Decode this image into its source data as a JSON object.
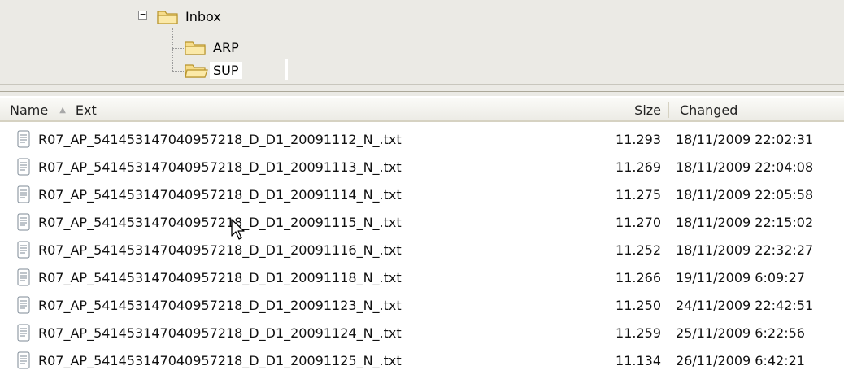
{
  "tree": {
    "nodes": [
      {
        "label": "Inbox",
        "expanded_symbol": "−"
      },
      {
        "label": "ARP"
      },
      {
        "label": "SUP"
      }
    ]
  },
  "list": {
    "columns": {
      "name": "Name",
      "ext": "Ext",
      "size": "Size",
      "changed": "Changed"
    },
    "sort_column": "name",
    "sort_direction": "ascending",
    "files": [
      {
        "name": "R07_AP_541453147040957218_D_D1_20091112_N_.txt",
        "size": "11.293",
        "changed": "18/11/2009 22:02:31"
      },
      {
        "name": "R07_AP_541453147040957218_D_D1_20091113_N_.txt",
        "size": "11.269",
        "changed": "18/11/2009 22:04:08"
      },
      {
        "name": "R07_AP_541453147040957218_D_D1_20091114_N_.txt",
        "size": "11.275",
        "changed": "18/11/2009 22:05:58"
      },
      {
        "name": "R07_AP_541453147040957218_D_D1_20091115_N_.txt",
        "size": "11.270",
        "changed": "18/11/2009 22:15:02"
      },
      {
        "name": "R07_AP_541453147040957218_D_D1_20091116_N_.txt",
        "size": "11.252",
        "changed": "18/11/2009 22:32:27"
      },
      {
        "name": "R07_AP_541453147040957218_D_D1_20091118_N_.txt",
        "size": "11.266",
        "changed": "19/11/2009 6:09:27"
      },
      {
        "name": "R07_AP_541453147040957218_D_D1_20091123_N_.txt",
        "size": "11.250",
        "changed": "24/11/2009 22:42:51"
      },
      {
        "name": "R07_AP_541453147040957218_D_D1_20091124_N_.txt",
        "size": "11.259",
        "changed": "25/11/2009 6:22:56"
      },
      {
        "name": "R07_AP_541453147040957218_D_D1_20091125_N_.txt",
        "size": "11.134",
        "changed": "26/11/2009 6:42:21"
      }
    ]
  },
  "colors": {
    "pane_background": "#ebeae5",
    "folder_fill": "#f6dc8a",
    "folder_stroke": "#b8942c"
  },
  "icons": {
    "folder": "folder-icon",
    "file": "text-file-icon",
    "sort": "sort-ascending-icon",
    "cursor": "mouse-cursor-icon"
  }
}
